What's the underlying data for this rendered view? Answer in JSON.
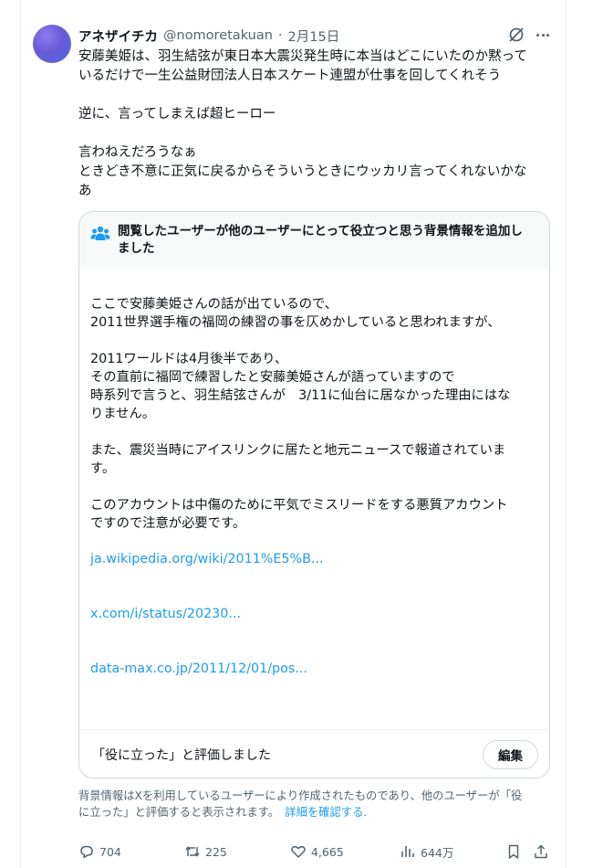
{
  "tweet": {
    "display_name": "アネザイチカ",
    "handle": "@nomoretakuan",
    "separator": "·",
    "date": "2月15日",
    "text_lines": [
      "安藤美姫は、羽生結弦が東日本大震災発生時に本当はどこにいたのか黙って",
      "いるだけで一生公益財団法人日本スケート連盟が仕事を回してくれそう",
      "",
      "逆に、言ってしまえば超ヒーロー",
      "",
      "言わねえだろうなぁ",
      "ときどき不意に正気に戻るからそういうときにウッカリ言ってくれないかな",
      "あ"
    ]
  },
  "community_note": {
    "title_line1": "閲覧したユーザーが他のユーザーにとって役立つと思う背景情報を追加し",
    "title_line2": "ました",
    "body_lines": [
      "ここで安藤美姫さんの話が出ているので、",
      "2011世界選手権の福岡の練習の事を仄めかしていると思われますが、",
      "",
      "2011ワールドは4月後半であり、",
      "その直前に福岡で練習したと安藤美姫さんが語っていますので",
      "時系列で言うと、羽生結弦さんが　3/11に仙台に居なかった理由にはな",
      "りません。",
      "",
      "また、震災当時にアイスリンクに居たと地元ニュースで報道されていま",
      "す。",
      "",
      "このアカウントは中傷のために平気でミスリードをする悪質アカウント",
      "ですので注意が必要です。"
    ],
    "links": [
      "ja.wikipedia.org/wiki/2011%E5%B...",
      "x.com/i/status/20230...",
      "data-max.co.jp/2011/12/01/pos..."
    ],
    "rated_text": "「役に立った」と評価しました",
    "edit_label": "編集"
  },
  "disclaimer": {
    "line1": "背景情報はXを利用しているユーザーにより作成されたものであり、他のユーザーが「役",
    "line2": "に立った」と評価すると表示されます。",
    "link": "詳細を確認する."
  },
  "actions": {
    "replies": "704",
    "reposts": "225",
    "likes": "4,665",
    "views": "644万"
  },
  "colors": {
    "link": "#1d9bf0",
    "secondary_text": "#536471",
    "border": "#cfd9de",
    "note_header_bg": "#f7f9f9"
  }
}
